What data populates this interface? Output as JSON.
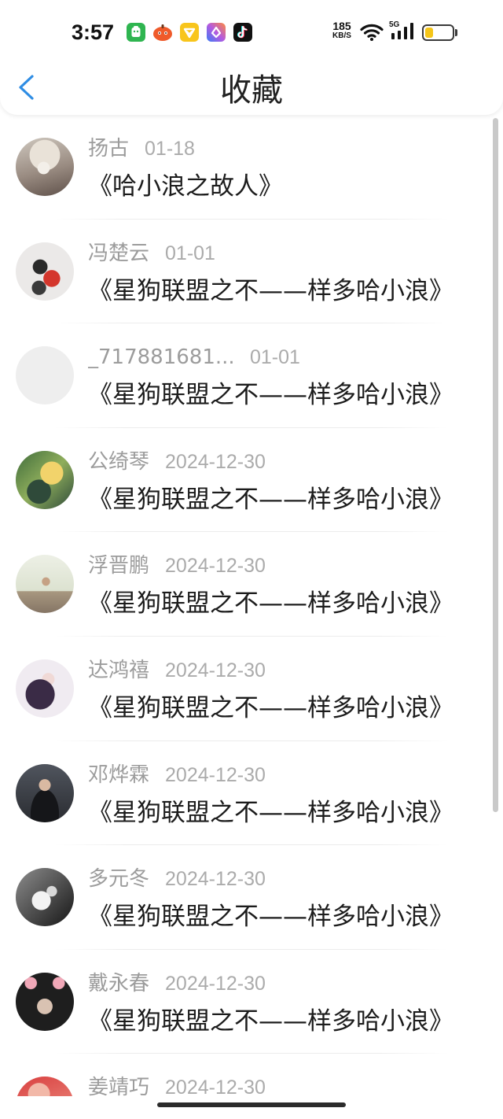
{
  "status_bar": {
    "time": "3:57",
    "app_icons": [
      "green-app-icon",
      "orange-app-icon",
      "yellow-app-icon",
      "gradient-app-icon",
      "tiktok-icon"
    ],
    "net_speed": "185",
    "net_speed_unit": "KB/S",
    "network_type": "5G",
    "battery_level": 0.3
  },
  "header": {
    "back_icon": "chevron-left-icon",
    "title": "收藏"
  },
  "items": [
    {
      "name": "扬古",
      "date": "01-18",
      "title": "《哈小浪之故人》"
    },
    {
      "name": "冯楚云",
      "date": "01-01",
      "title": "《星狗联盟之不——样多哈小浪》"
    },
    {
      "name": "_717881681...",
      "date": "01-01",
      "title": "《星狗联盟之不——样多哈小浪》"
    },
    {
      "name": "公绮琴",
      "date": "2024-12-30",
      "title": "《星狗联盟之不——样多哈小浪》"
    },
    {
      "name": "浮晋鹏",
      "date": "2024-12-30",
      "title": "《星狗联盟之不——样多哈小浪》"
    },
    {
      "name": "达鸿禧",
      "date": "2024-12-30",
      "title": "《星狗联盟之不——样多哈小浪》"
    },
    {
      "name": "邓烨霖",
      "date": "2024-12-30",
      "title": "《星狗联盟之不——样多哈小浪》"
    },
    {
      "name": "多元冬",
      "date": "2024-12-30",
      "title": "《星狗联盟之不——样多哈小浪》"
    },
    {
      "name": "戴永春",
      "date": "2024-12-30",
      "title": "《星狗联盟之不——样多哈小浪》"
    },
    {
      "name": "姜靖巧",
      "date": "2024-12-30"
    }
  ],
  "theme": {
    "accent": "#2f8de4",
    "battery_fill": "#f5c518"
  }
}
